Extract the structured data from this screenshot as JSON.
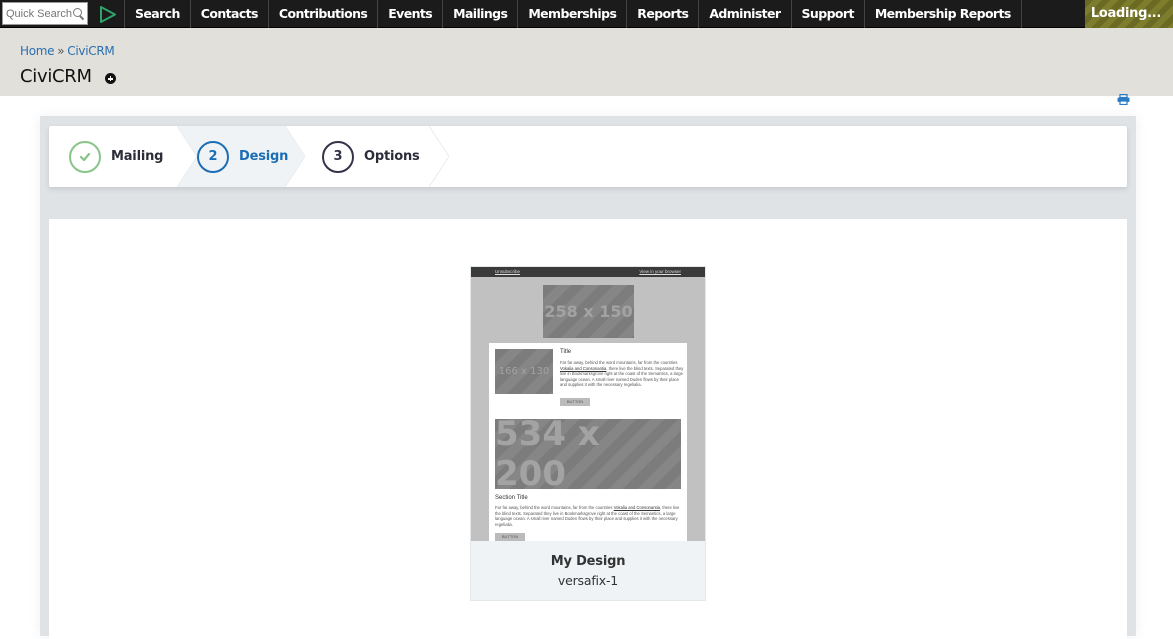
{
  "menubar": {
    "quick_search_placeholder": "Quick Search",
    "logo_icon": "civicrm-logo-icon",
    "items": [
      "Search",
      "Contacts",
      "Contributions",
      "Events",
      "Mailings",
      "Memberships",
      "Reports",
      "Administer",
      "Support",
      "Membership Reports"
    ],
    "loading_label": "Loading..."
  },
  "header": {
    "breadcrumb": [
      "Home",
      "CiviCRM"
    ],
    "breadcrumb_separator": "»",
    "title": "CiviCRM"
  },
  "toolbar": {
    "print_icon": "print-icon"
  },
  "wizard": {
    "steps": [
      {
        "badge": "✔",
        "label": "Mailing",
        "state": "complete",
        "color": "#88c48a"
      },
      {
        "badge": "2",
        "label": "Design",
        "state": "active",
        "color": "#1b6db4"
      },
      {
        "badge": "3",
        "label": "Options",
        "state": "pending",
        "color": "#33334a"
      }
    ]
  },
  "template_card": {
    "name": "My Design",
    "template_id": "versafix-1",
    "preview": {
      "unsubscribe_link": "Unsubscribe",
      "view_in_browser_link": "View in your browser",
      "hero_placeholder": "258 x 150",
      "side_placeholder": "166 x 130",
      "block_title": "Title",
      "block_text_before_link": "Far far away, behind the word mountains, far from the countries ",
      "block_link": "Vokalia and Consonantia",
      "block_text_after_link": ", there live the blind texts. Separated they live in Bookmarksgrove right at the coast of the Semantics, a large language ocean. A small river named Duden flows by their place and supplies it with the necessary regelialia.",
      "button_label": "BUTTON",
      "big_placeholder": "534 x 200",
      "section_title": "Section Title",
      "section_text_before_link": "Far far away, behind the word mountains, far from the countries ",
      "section_link": "Vokalia and Consonantia",
      "section_text_after_link": ", there live the blind texts. Separated they live in Bookmarksgrove right at the coast of the Semantics, a large language ocean. A small river named Duden flows by their place and supplies it with the necessary regelialia.",
      "section_button_label": "BUTTON"
    }
  }
}
